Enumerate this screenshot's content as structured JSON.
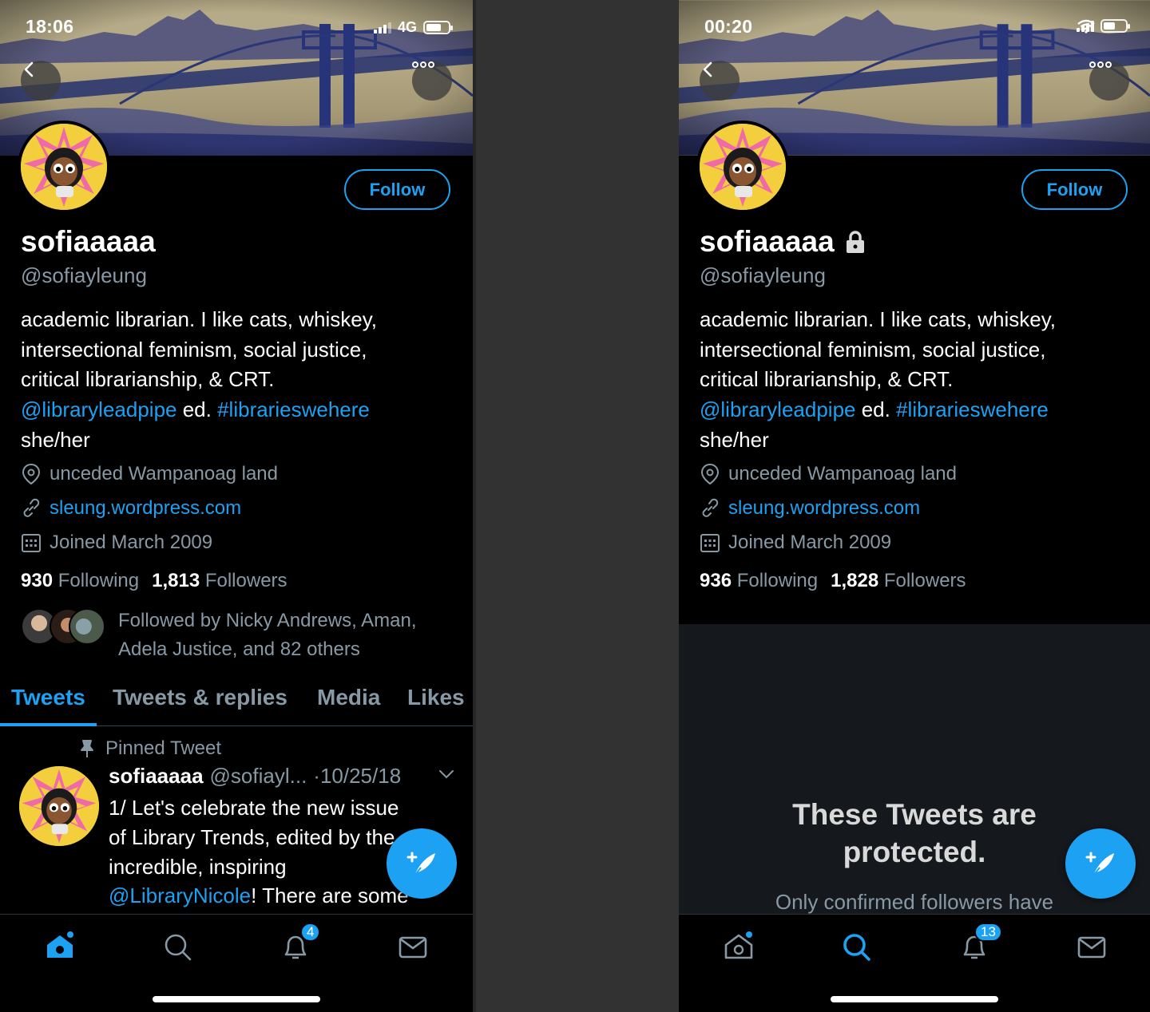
{
  "colors": {
    "accent": "#1da1f2",
    "muted": "#8899a6",
    "background": "#000000",
    "divider": "#323233",
    "protected_bg": "#15181c"
  },
  "left": {
    "status": {
      "time": "18:06",
      "network": "4G"
    },
    "profile": {
      "name": "sofiaaaaa",
      "handle": "@sofiayleung",
      "follow_label": "Follow",
      "bio_lines": [
        "academic librarian. I like cats, whiskey,",
        "intersectional feminism, social justice,",
        "critical librarianship, & CRT."
      ],
      "bio_mention": "@libraryleadpipe",
      "bio_mid": " ed. ",
      "bio_hashtag": "#librarieswehere",
      "bio_pronouns": "she/her",
      "location": "unceded Wampanoag land",
      "website": "sleung.wordpress.com",
      "joined": "Joined March 2009",
      "following_count": "930",
      "following_label": "Following",
      "followers_count": "1,813",
      "followers_label": "Followers",
      "followed_by": "Followed by Nicky Andrews, Aman, Adela Justice, and 82 others"
    },
    "tabs": [
      "Tweets",
      "Tweets & replies",
      "Media",
      "Likes"
    ],
    "pinned_label": "Pinned Tweet",
    "tweet": {
      "name": "sofiaaaaa",
      "handle": "@sofiayl...",
      "date": "·10/25/18",
      "line1": "1/ Let's celebrate the new issue",
      "line2": "of Library Trends, edited by the",
      "line3": "incredible, inspiring",
      "mention": "@LibraryNicole",
      "line4_rest": "! There are some"
    },
    "notifications_badge": "4"
  },
  "right": {
    "status": {
      "time": "00:20"
    },
    "profile": {
      "name": "sofiaaaaa",
      "handle": "@sofiayleung",
      "follow_label": "Follow",
      "bio_lines": [
        "academic librarian. I like cats, whiskey,",
        "intersectional feminism, social justice,",
        "critical librarianship, & CRT."
      ],
      "bio_mention": "@libraryleadpipe",
      "bio_mid": " ed. ",
      "bio_hashtag": "#librarieswehere",
      "bio_pronouns": "she/her",
      "location": "unceded Wampanoag land",
      "website": "sleung.wordpress.com",
      "joined": "Joined March 2009",
      "following_count": "936",
      "following_label": "Following",
      "followers_count": "1,828",
      "followers_label": "Followers"
    },
    "protected_title_1": "These Tweets are",
    "protected_title_2": "protected.",
    "protected_sub": "Only confirmed followers have",
    "notifications_badge": "13"
  }
}
